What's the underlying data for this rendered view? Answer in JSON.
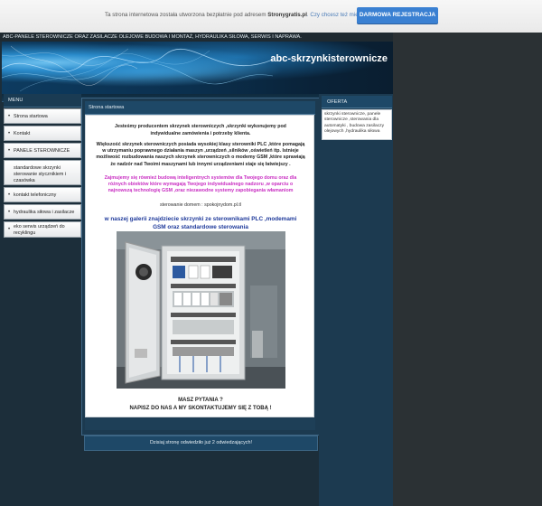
{
  "topbar": {
    "notice_prefix": "Ta strona internetowa została utworzona bezpłatnie pod adresem",
    "notice_site": "Stronygratis.pl",
    "notice_suffix": ". Czy chcesz też mieć własną stronę?",
    "register_button": "DARMOWA REJESTRACJA"
  },
  "site": {
    "header_strip": "ABC-PANELE STEROWNICZE ORAZ ZASILACZE OLEJOWE BUDOWA I MONTAŻ, HYDRAULIKA SIŁOWA, SERWIS I NAPRAWA.",
    "banner_title": "abc-skrzynkisterownicze"
  },
  "menu": {
    "header": "MENU",
    "items": [
      {
        "label": "Strona startowa"
      },
      {
        "label": "Kontakt"
      },
      {
        "label": "PANELE STEROWNICZE PLC"
      },
      {
        "label": "standardowe skrzynki sterowanie stycznikiem i czasówka"
      },
      {
        "label": "kontakt telefoniczny"
      },
      {
        "label": "hydraulika siłowa i zasilacze"
      },
      {
        "label": "eko serwis urządzeń do recyklingu"
      }
    ]
  },
  "content": {
    "header": "Strona startowa",
    "p1": "Jesteśmy producentem skrzynek sterowniczych ,skrzynki wykonujemy pod indywidualne zamówienia i potrzeby klienta.",
    "p2": "Większość skrzynek sterowniczych posiada wysokiej  klasy sterowniki PLC ,które pomagają w utrzymaniu poprawnego działania maszyn ,urządzeń ,silników ,oświetleń itp. Istnieje możliwość rozbudowania naszych skrzynek sterowniczych o modemy GSM ,które sprawiają że nadzór nad Twoimi maszynami lub innymi urządzeniami staje się łatwiejszy .",
    "p3": "Zajmujemy się również budową inteligentnych systemów dla Twojego domu oraz dla różnych obiektów które wymagają Twojego indywidualnego nadzoru ,w oparciu o najnowszą technologię GSM ,oraz niezawodne systemy zapobiegania włamaniom",
    "p4": "sterowanie domem :  spokojnydom.pl.tl",
    "p5": "w naszej galerii znajdziecie skrzynki ze sterownikami PLC ,modemami GSM oraz standardowe sterowania",
    "p6_line1": "MASZ PYTANIA ?",
    "p6_line2": "NAPISZ DO NAS A MY SKONTAKTUJEMY SIĘ Z TOBĄ !",
    "visit_counter": "Dzisiaj stronę odwiedziło już 2 odwiedzających!"
  },
  "offer": {
    "header": "OFERTA",
    "text": "skrzynki sterownicze, panele sterownicze ,sterowania dla automatyki , budowa zasilaczy olejowych ,hydraulika siłowa"
  }
}
